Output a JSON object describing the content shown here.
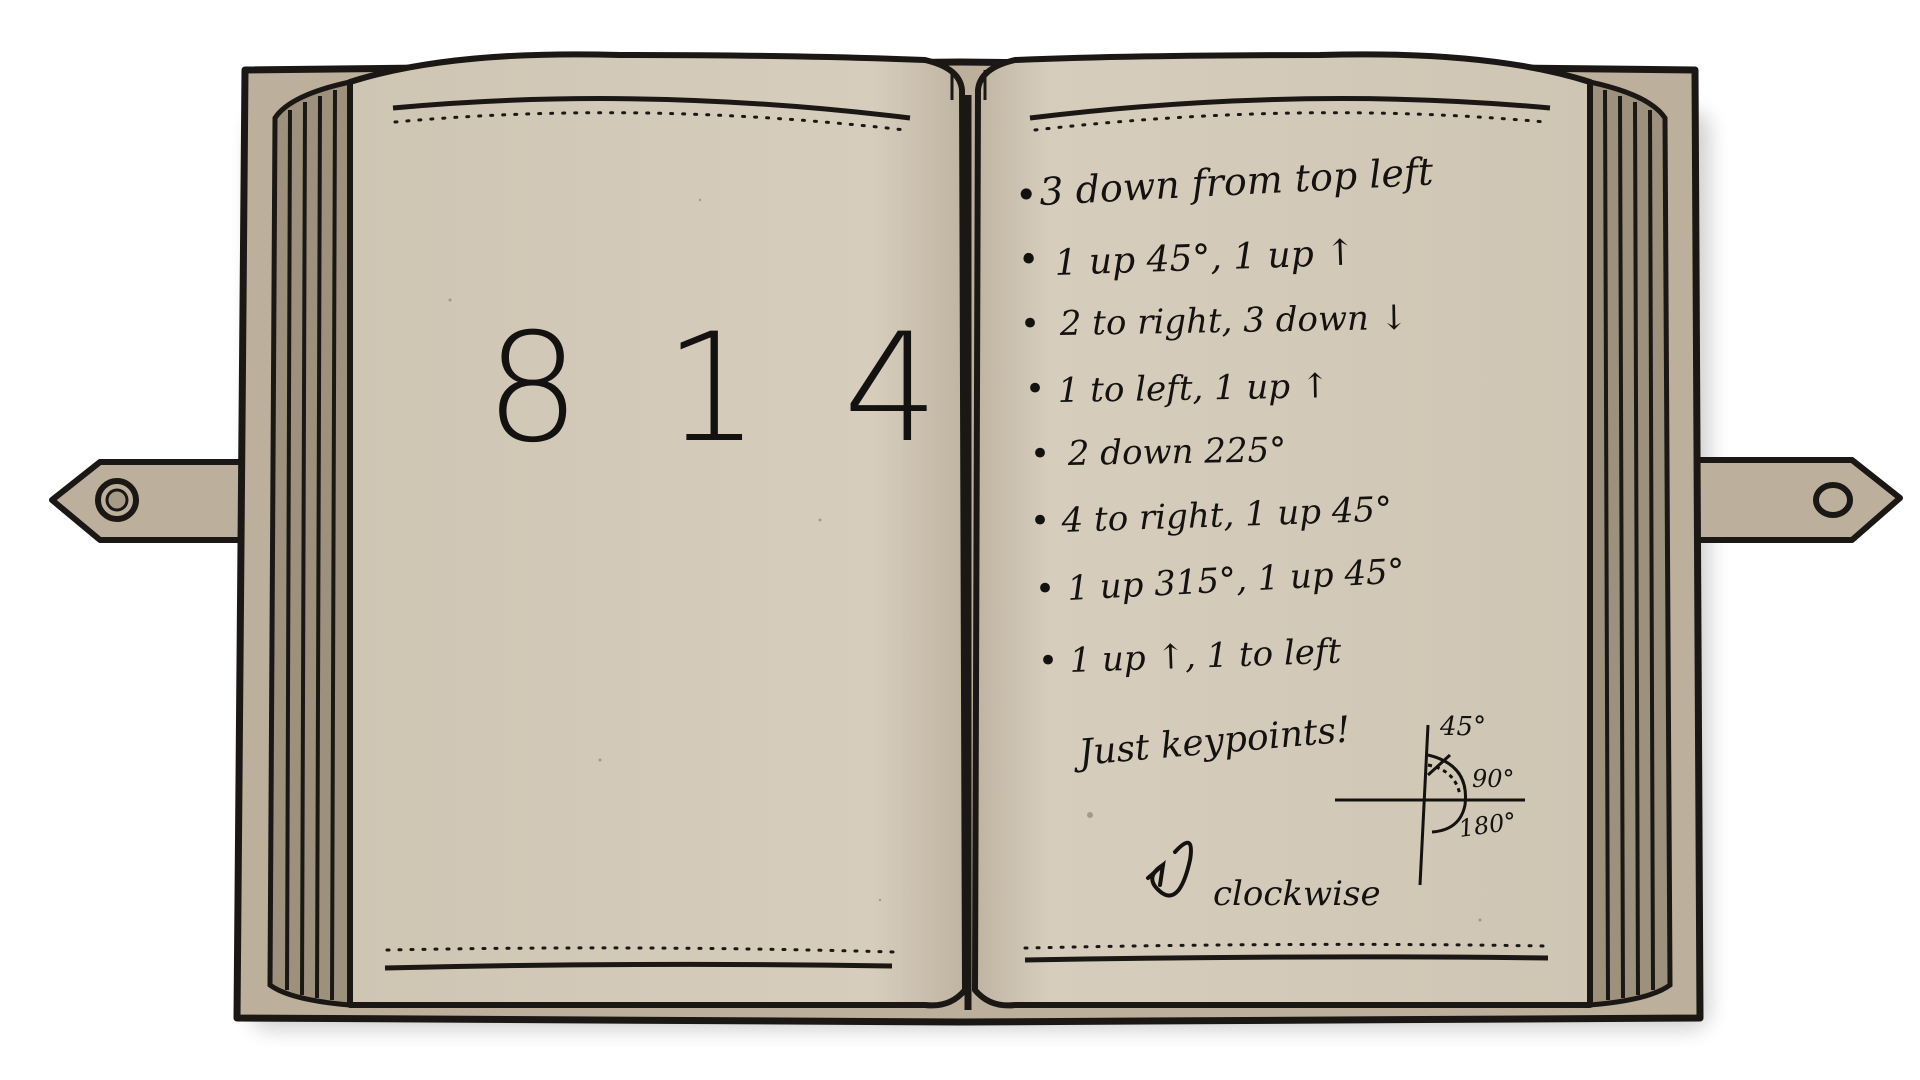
{
  "left_page": {
    "code": "8 1 4"
  },
  "right_page": {
    "instructions": [
      "3 down from top left",
      "1 up 45°, 1 up ↑",
      "2 to right, 3 down ↓",
      "1 to left, 1 up ↑",
      "2 down 225°",
      "4 to right, 1 up 45°",
      "1 up 315°, 1 up 45°",
      "1 up ↑, 1 to left"
    ],
    "note": "Just keypoints!",
    "angles": {
      "a45": "45°",
      "a90": "90°",
      "a180": "180°"
    },
    "direction": "clockwise"
  },
  "colors": {
    "paper": "#d5cbbb",
    "cover": "#bcb09c",
    "ink": "#141210",
    "outline": "#1a1714"
  }
}
